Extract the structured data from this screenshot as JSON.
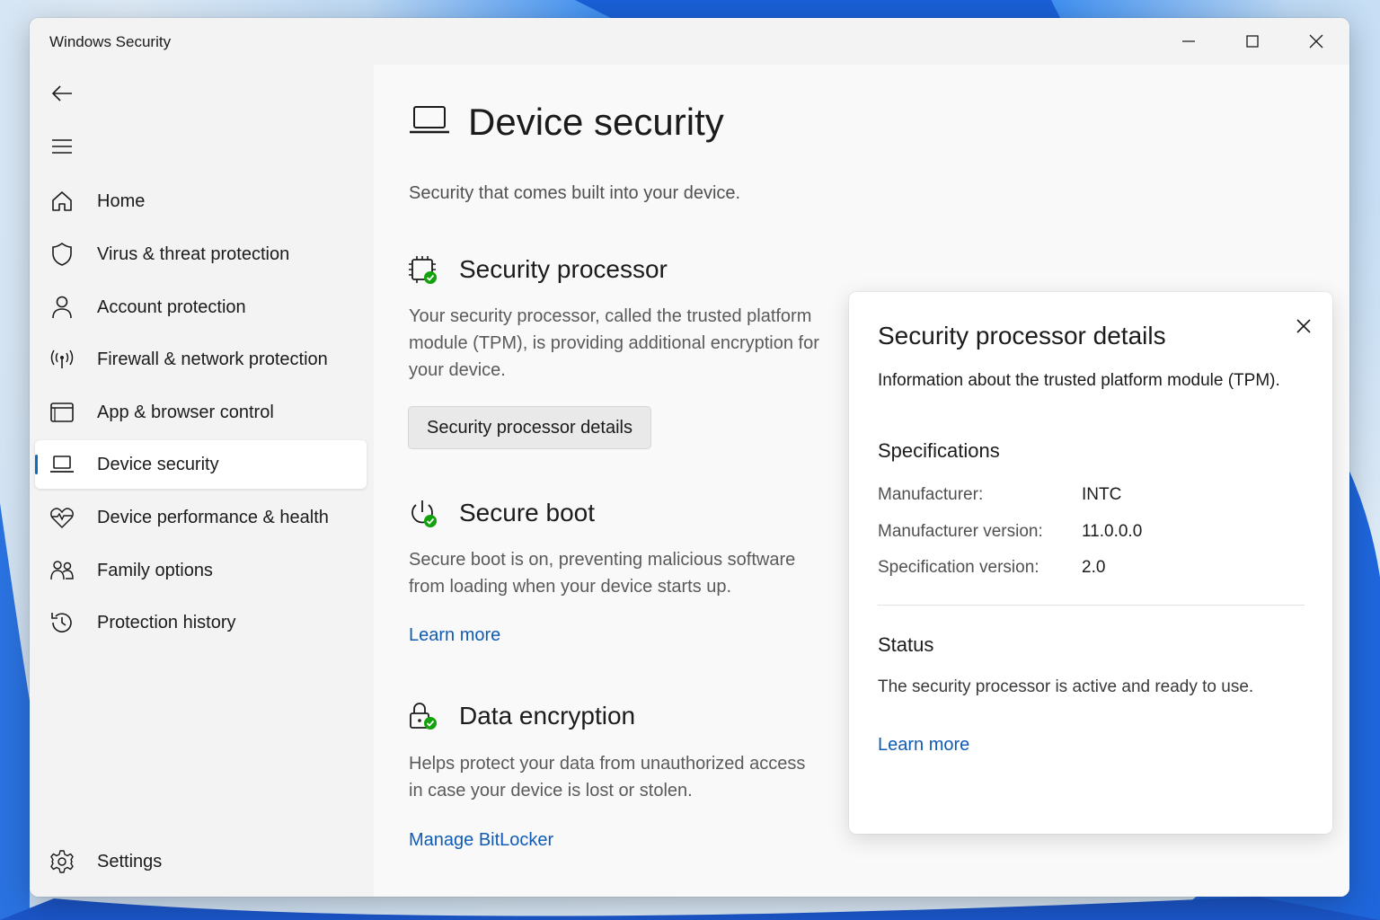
{
  "window": {
    "title": "Windows Security",
    "controls": {
      "minimize": "minimize-icon",
      "maximize": "maximize-icon",
      "close": "close-icon"
    }
  },
  "sidebar": {
    "items": [
      {
        "label": "Home",
        "icon": "home-icon"
      },
      {
        "label": "Virus & threat protection",
        "icon": "shield-icon"
      },
      {
        "label": "Account protection",
        "icon": "person-icon"
      },
      {
        "label": "Firewall & network protection",
        "icon": "wireless-icon"
      },
      {
        "label": "App & browser control",
        "icon": "browser-window-icon"
      },
      {
        "label": "Device security",
        "icon": "laptop-icon",
        "active": true
      },
      {
        "label": "Device performance & health",
        "icon": "heart-pulse-icon"
      },
      {
        "label": "Family options",
        "icon": "family-icon"
      },
      {
        "label": "Protection history",
        "icon": "history-icon"
      }
    ],
    "settings_label": "Settings"
  },
  "main": {
    "title": "Device security",
    "subtitle": "Security that comes built into your device.",
    "sections": {
      "processor": {
        "title": "Security processor",
        "description": "Your security processor, called the trusted platform module (TPM), is providing additional encryption for your device.",
        "button_label": "Security processor details"
      },
      "boot": {
        "title": "Secure boot",
        "description": "Secure boot is on, preventing malicious software from loading when your device starts up.",
        "link": "Learn more"
      },
      "encryption": {
        "title": "Data encryption",
        "description": "Helps protect your data from unauthorized access in case your device is lost or stolen.",
        "link": "Manage BitLocker"
      }
    }
  },
  "panel": {
    "title": "Security processor details",
    "description": "Information about the trusted platform module (TPM).",
    "specs_heading": "Specifications",
    "specs": [
      {
        "key": "Manufacturer:",
        "value": "INTC"
      },
      {
        "key": "Manufacturer version:",
        "value": "11.0.0.0"
      },
      {
        "key": "Specification version:",
        "value": "2.0"
      }
    ],
    "status_heading": "Status",
    "status_text": "The security processor is active and ready to use.",
    "link": "Learn more"
  },
  "colors": {
    "accent": "#0f6cbd",
    "link": "#0f5bb5",
    "check": "#13a10e"
  }
}
